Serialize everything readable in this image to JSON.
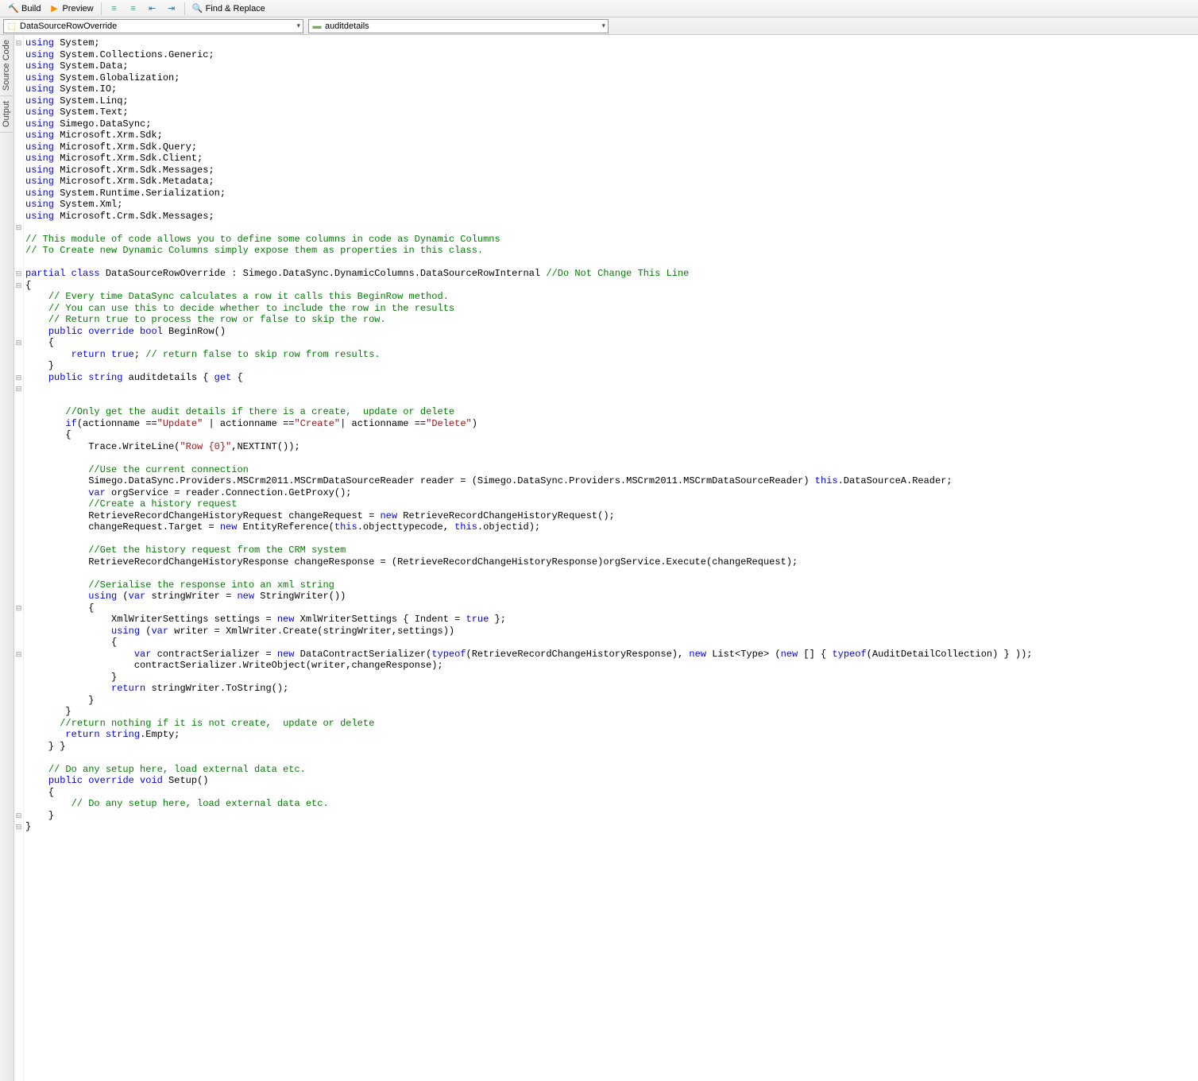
{
  "toolbar": {
    "build": "Build",
    "preview": "Preview",
    "find": "Find & Replace"
  },
  "dropdowns": {
    "left": "DataSourceRowOverride",
    "right": "auditdetails"
  },
  "side": {
    "t1": "Source Code",
    "t2": "Output"
  },
  "gutter": [
    "⊟",
    "",
    "",
    "",
    "",
    "",
    "",
    "",
    "",
    "",
    "",
    "",
    "",
    "",
    "",
    "",
    "⊟",
    "",
    "",
    "",
    "⊟",
    "⊟",
    "",
    "",
    "",
    "",
    "⊟",
    "",
    "",
    "⊟",
    "⊟",
    "",
    "",
    "",
    "",
    "",
    "",
    "",
    "",
    "",
    "",
    "",
    "",
    "",
    "",
    "",
    "",
    "",
    "",
    "⊟",
    "",
    "",
    "",
    "⊟",
    "",
    "",
    "",
    "",
    "",
    "",
    "",
    "",
    "",
    "",
    "",
    "",
    "",
    "⊟",
    "⊟",
    "",
    "",
    "",
    ""
  ],
  "code_lines_html": [
    "<span class='kw'>using</span> System;",
    "<span class='kw'>using</span> System.Collections.Generic;",
    "<span class='kw'>using</span> System.Data;",
    "<span class='kw'>using</span> System.Globalization;",
    "<span class='kw'>using</span> System.IO;",
    "<span class='kw'>using</span> System.Linq;",
    "<span class='kw'>using</span> System.Text;",
    "<span class='kw'>using</span> Simego.DataSync;",
    "<span class='kw'>using</span> Microsoft.Xrm.Sdk;",
    "<span class='kw'>using</span> Microsoft.Xrm.Sdk.Query;",
    "<span class='kw'>using</span> Microsoft.Xrm.Sdk.Client;",
    "<span class='kw'>using</span> Microsoft.Xrm.Sdk.Messages;",
    "<span class='kw'>using</span> Microsoft.Xrm.Sdk.Metadata;",
    "<span class='kw'>using</span> System.Runtime.Serialization;",
    "<span class='kw'>using</span> System.Xml;",
    "<span class='kw'>using</span> Microsoft.Crm.Sdk.Messages;",
    "",
    "<span class='cm'>// This module of code allows you to define some columns in code as Dynamic Columns</span>",
    "<span class='cm'>// To Create new Dynamic Columns simply expose them as properties in this class.</span>",
    "",
    "<span class='kw'>partial</span> <span class='kw'>class</span> DataSourceRowOverride : Simego.DataSync.DynamicColumns.DataSourceRowInternal <span class='cm'>//Do Not Change This Line</span>",
    "{",
    "    <span class='cm'>// Every time DataSync calculates a row it calls this BeginRow method.</span>",
    "    <span class='cm'>// You can use this to decide whether to include the row in the results</span>",
    "    <span class='cm'>// Return true to process the row or false to skip the row.</span>",
    "    <span class='kw'>public</span> <span class='kw'>override</span> <span class='kw'>bool</span> BeginRow()",
    "    {",
    "        <span class='kw'>return</span> <span class='kw'>true</span>; <span class='cm'>// return false to skip row from results.</span>",
    "    }",
    "    <span class='kw'>public</span> <span class='kw'>string</span> auditdetails { <span class='kw'>get</span> {",
    "",
    "",
    "       <span class='cm'>//Only get the audit details if there is a create,  update or delete</span>",
    "       <span class='kw'>if</span>(actionname ==<span class='st'>\"Update\"</span> | actionname ==<span class='st'>\"Create\"</span>| actionname ==<span class='st'>\"Delete\"</span>)",
    "       {",
    "           Trace.WriteLine(<span class='st'>\"Row {0}\"</span>,NEXTINT());",
    "",
    "           <span class='cm'>//Use the current connection</span>",
    "           Simego.DataSync.Providers.MSCrm2011.MSCrmDataSourceReader reader = (Simego.DataSync.Providers.MSCrm2011.MSCrmDataSourceReader) <span class='kw'>this</span>.DataSourceA.Reader;",
    "           <span class='kw'>var</span> orgService = reader.Connection.GetProxy();",
    "           <span class='cm'>//Create a history request</span>",
    "           RetrieveRecordChangeHistoryRequest changeRequest = <span class='kw'>new</span> RetrieveRecordChangeHistoryRequest();",
    "           changeRequest.Target = <span class='kw'>new</span> EntityReference(<span class='kw'>this</span>.objecttypecode, <span class='kw'>this</span>.objectid);",
    "",
    "           <span class='cm'>//Get the history request from the CRM system</span>",
    "           RetrieveRecordChangeHistoryResponse changeResponse = (RetrieveRecordChangeHistoryResponse)orgService.Execute(changeRequest);",
    "",
    "           <span class='cm'>//Serialise the response into an xml string</span>",
    "           <span class='kw'>using</span> (<span class='kw'>var</span> stringWriter = <span class='kw'>new</span> StringWriter())",
    "           {",
    "               XmlWriterSettings settings = <span class='kw'>new</span> XmlWriterSettings { Indent = <span class='kw'>true</span> };",
    "               <span class='kw'>using</span> (<span class='kw'>var</span> writer = XmlWriter.Create(stringWriter,settings))",
    "               {",
    "                   <span class='kw'>var</span> contractSerializer = <span class='kw'>new</span> DataContractSerializer(<span class='kw'>typeof</span>(RetrieveRecordChangeHistoryResponse), <span class='kw'>new</span> List&lt;Type&gt; (<span class='kw'>new</span> [] { <span class='kw'>typeof</span>(AuditDetailCollection) } ));",
    "                   contractSerializer.WriteObject(writer,changeResponse);",
    "               }",
    "               <span class='kw'>return</span> stringWriter.ToString();",
    "           }",
    "       }",
    "      <span class='cm'>//return nothing if it is not create,  update or delete</span>",
    "       <span class='kw'>return</span> <span class='kw'>string</span>.Empty;",
    "    } }",
    "",
    "    <span class='cm'>// Do any setup here, load external data etc.</span>",
    "    <span class='kw'>public</span> <span class='kw'>override</span> <span class='kw'>void</span> Setup()",
    "    {",
    "        <span class='cm'>// Do any setup here, load external data etc.</span>",
    "    }",
    "}"
  ]
}
